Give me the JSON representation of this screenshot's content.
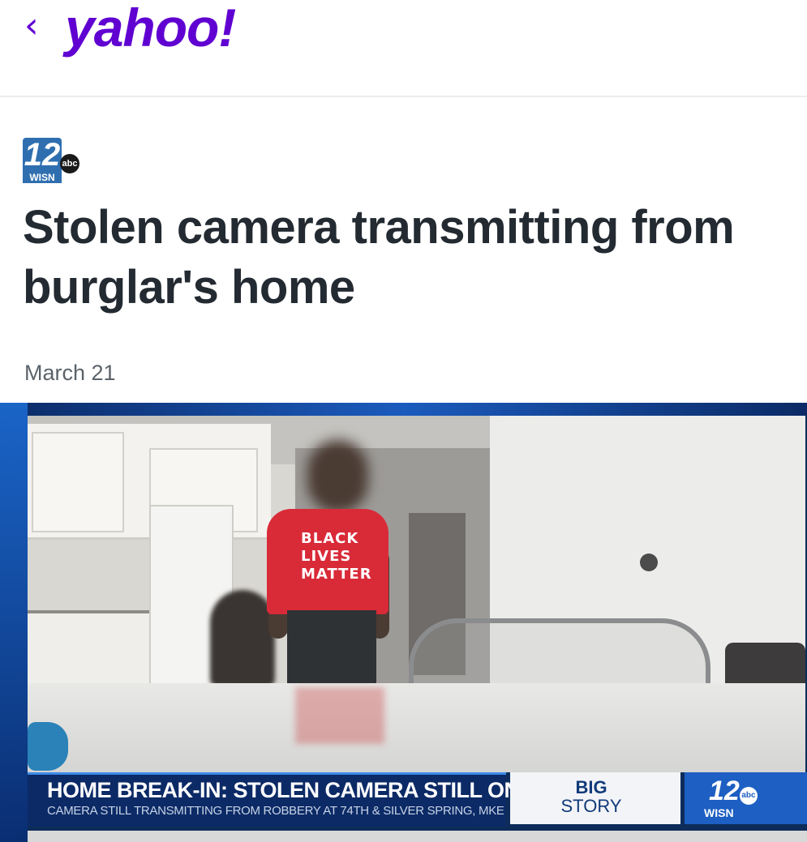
{
  "header": {
    "back_glyph": "‹",
    "logo": "yahoo!",
    "brand_color": "#6001d2"
  },
  "source": {
    "number": "12",
    "network": "abc",
    "station": "WISN"
  },
  "article": {
    "headline": "Stolen camera transmitting from burglar's home",
    "date": "March 21"
  },
  "video": {
    "shirt_text": "BLACK LIVES MATTER",
    "lower_third": {
      "headline": "HOME BREAK-IN: STOLEN CAMERA STILL ON",
      "subline": "CAMERA STILL TRANSMITTING FROM ROBBERY AT 74TH & SILVER SPRING, MKE",
      "tag_line1": "BIG",
      "tag_line2": "STORY",
      "channel_number": "12",
      "channel_network": "abc",
      "channel_station": "WISN"
    }
  }
}
